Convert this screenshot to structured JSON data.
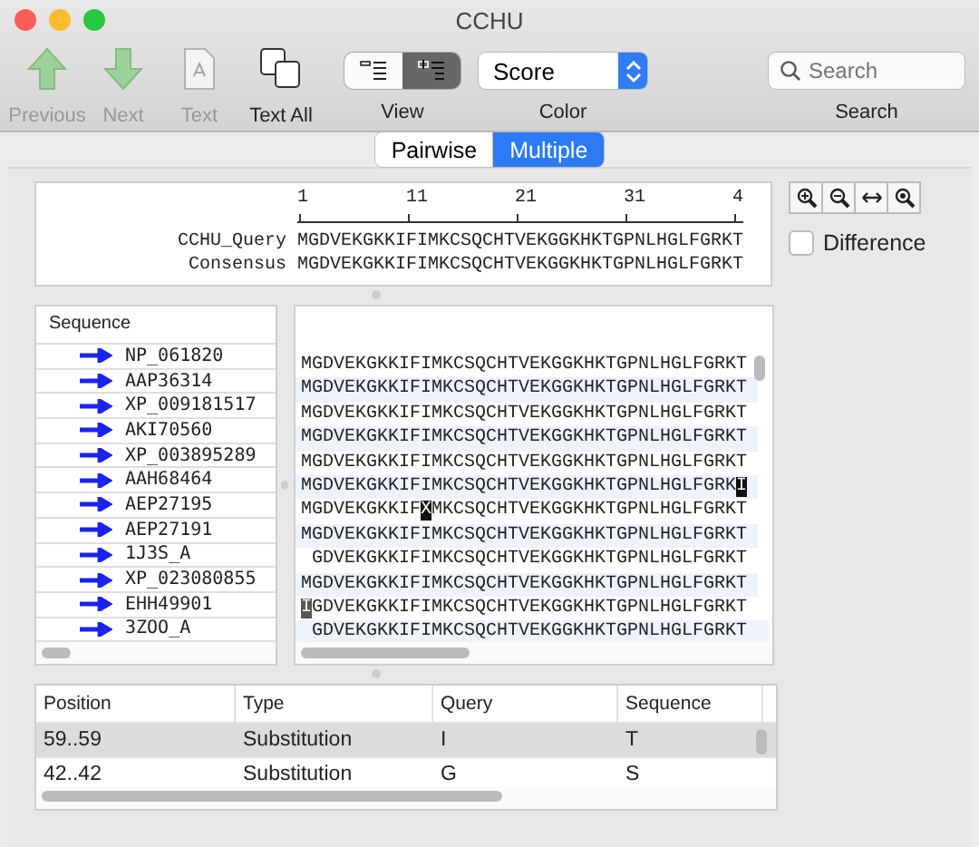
{
  "window": {
    "title": "CCHU"
  },
  "toolbar": {
    "items": [
      {
        "label": "Previous",
        "kind": "up",
        "disabled": true
      },
      {
        "label": "Next",
        "kind": "down",
        "disabled": true
      },
      {
        "label": "Text",
        "kind": "text",
        "disabled": true
      },
      {
        "label": "Text All",
        "kind": "textall",
        "disabled": false
      }
    ],
    "view": {
      "label": "View",
      "options": [
        {
          "kind": "list",
          "selected": false
        },
        {
          "kind": "indent",
          "selected": true
        }
      ]
    },
    "color": {
      "label": "Color",
      "value": "Score"
    },
    "search": {
      "label": "Search",
      "placeholder": "Search"
    }
  },
  "mode_tabs": [
    {
      "label": "Pairwise",
      "selected": false
    },
    {
      "label": "Multiple",
      "selected": true
    }
  ],
  "overview": {
    "ruler": [
      "1",
      "11",
      "21",
      "31",
      "4"
    ],
    "rows": [
      {
        "name": "CCHU_Query",
        "sequence": "MGDVEKGKKIFIMKCSQCHTVEKGGKHKTGPNLHGLFGRKT"
      },
      {
        "name": "Consensus",
        "sequence": "MGDVEKGKKIFIMKCSQCHTVEKGGKHKTGPNLHGLFGRKT"
      }
    ]
  },
  "zoom_tools": [
    {
      "kind": "zoom-in"
    },
    {
      "kind": "zoom-out"
    },
    {
      "kind": "fit"
    },
    {
      "kind": "zoom-reset"
    }
  ],
  "difference": {
    "label": "Difference",
    "checked": false
  },
  "sequence_list": {
    "header": "Sequence",
    "items": [
      "NP_061820",
      "AAP36314",
      "XP_009181517",
      "AKI70560",
      "XP_003895289",
      "AAH68464",
      "AEP27195",
      "AEP27191",
      "1J3S_A",
      "XP_023080855",
      "EHH49901",
      "3ZOO_A"
    ]
  },
  "alignment": {
    "rows": [
      {
        "gap": false,
        "segments": [
          {
            "text": "MGDVEKGKKIFIMKCSQCHTVEKGGKHKTGPNLHGLFGRKT",
            "kind": "plain"
          }
        ]
      },
      {
        "gap": false,
        "segments": [
          {
            "text": "MGDVEKGKKIFIMKCSQCHTVEKGGKHKTGPNLHGLFGRKT",
            "kind": "plain"
          }
        ]
      },
      {
        "gap": false,
        "segments": [
          {
            "text": "MGDVEKGKKIFIMKCSQCHTVEKGGKHKTGPNLHGLFGRKT",
            "kind": "plain"
          }
        ]
      },
      {
        "gap": false,
        "segments": [
          {
            "text": "MGDVEKGKKIFIMKCSQCHTVEKGGKHKTGPNLHGLFGRKT",
            "kind": "plain"
          }
        ]
      },
      {
        "gap": false,
        "segments": [
          {
            "text": "MGDVEKGKKIFIMKCSQCHTVEKGGKHKTGPNLHGLFGRKT",
            "kind": "plain"
          }
        ]
      },
      {
        "gap": false,
        "segments": [
          {
            "text": "MGDVEKGKKIFIMKCSQCHTVEKGGKHKTGPNLHGLFGRK",
            "kind": "plain"
          },
          {
            "text": "I",
            "kind": "mismatch"
          }
        ]
      },
      {
        "gap": false,
        "segments": [
          {
            "text": "MGDVEKGKKIF",
            "kind": "plain"
          },
          {
            "text": "X",
            "kind": "mismatch"
          },
          {
            "text": "MKCSQCHTVEKGGKHKTGPNLHGLFGRKT",
            "kind": "plain"
          }
        ]
      },
      {
        "gap": false,
        "segments": [
          {
            "text": "MGDVEKGKKIFIMKCSQCHTVEKGGKHKTGPNLHGLFGRKT",
            "kind": "plain"
          }
        ]
      },
      {
        "gap": true,
        "segments": [
          {
            "text": "GDVEKGKKIFIMKCSQCHTVEKGGKHKTGPNLHGLFGRKT",
            "kind": "plain"
          }
        ]
      },
      {
        "gap": false,
        "segments": [
          {
            "text": "MGDVEKGKKIFIMKCSQCHTVEKGGKHKTGPNLHGLFGRKT",
            "kind": "plain"
          }
        ]
      },
      {
        "gap": false,
        "segments": [
          {
            "text": "I",
            "kind": "selected"
          },
          {
            "text": "GDVEKGKKIFIMKCSQCHTVEKGGKHKTGPNLHGLFGRKT",
            "kind": "plain"
          }
        ]
      },
      {
        "gap": true,
        "segments": [
          {
            "text": "GDVEKGKKIFIMKCSQCHTVEKGGKHKTGPNLHGLFGRKT",
            "kind": "plain"
          }
        ]
      }
    ]
  },
  "differences_table": {
    "columns": [
      "Position",
      "Type",
      "Query",
      "Sequence"
    ],
    "rows": [
      {
        "cells": [
          "59..59",
          "Substitution",
          "I",
          "T"
        ],
        "selected": true
      },
      {
        "cells": [
          "42..42",
          "Substitution",
          "G",
          "S"
        ],
        "selected": false
      }
    ]
  }
}
